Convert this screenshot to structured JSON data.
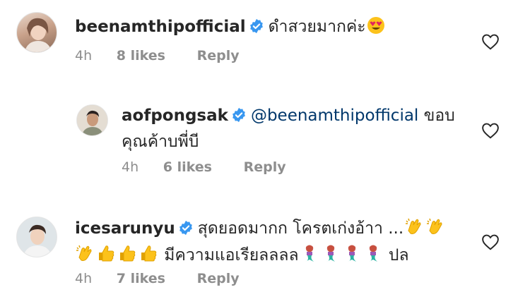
{
  "comments": [
    {
      "username": "beenamthipofficial",
      "verified": true,
      "text": "ดำสวยมากค่ะ",
      "emoji_after": "heart-eyes-emoji",
      "time": "4h",
      "likes": "8 likes",
      "reply": "Reply"
    },
    {
      "username": "aofpongsak",
      "verified": true,
      "mention": "@beenamthipofficial",
      "text_line1": " ขอบ",
      "text_line2": "คุณค้าบพี่บี",
      "time": "4h",
      "likes": "6 likes",
      "reply": "Reply"
    },
    {
      "username": "icesarunyu",
      "verified": true,
      "text_line1": "สุดยอดมากก โครตเก่งอ้าา ...",
      "text_line2_mid": " มีความแอเรียลลลล",
      "text_line2_end": " ปล",
      "emojis_line1": [
        "clapping-hands-emoji",
        "clapping-hands-emoji"
      ],
      "emojis_line2_start": [
        "clapping-hands-emoji",
        "thumbs-up-emoji",
        "thumbs-up-emoji",
        "thumbs-up-emoji"
      ],
      "emojis_line2_mid": [
        "mermaid-emoji",
        "mermaid-emoji",
        "mermaid-emoji",
        "mermaid-emoji"
      ],
      "time": "4h",
      "likes": "7 likes",
      "reply": "Reply"
    }
  ],
  "colors": {
    "verified": "#3897f0",
    "mention": "#00376b",
    "meta": "#8e8e8e"
  }
}
